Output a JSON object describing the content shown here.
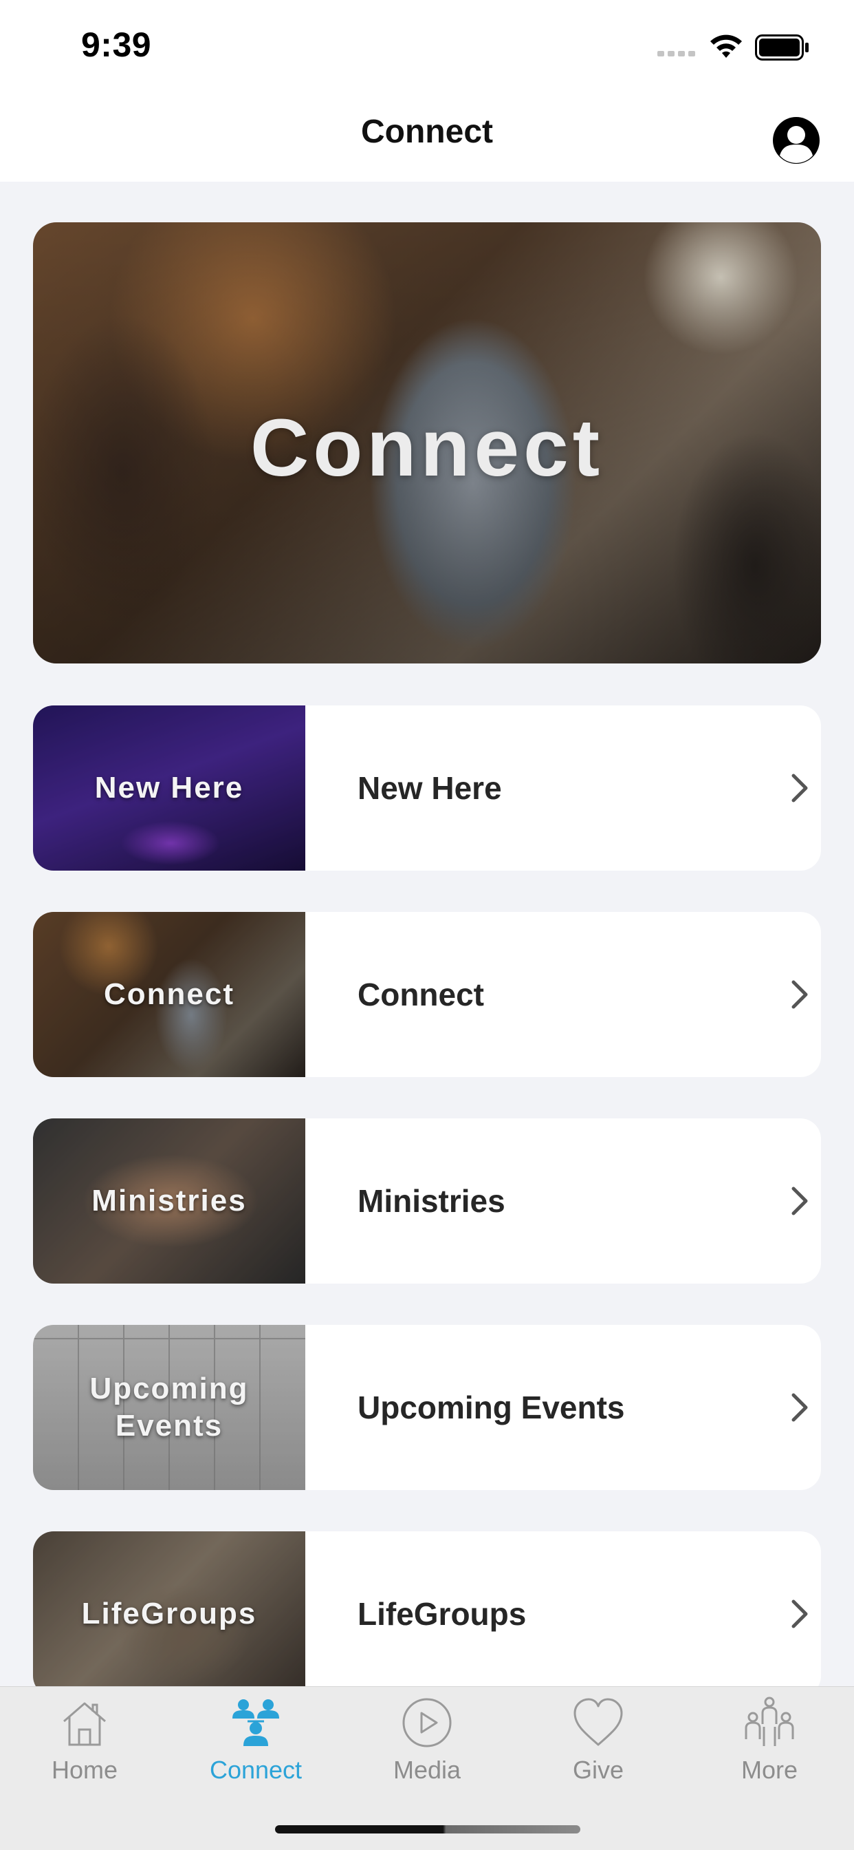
{
  "status_bar": {
    "time": "9:39",
    "icons": [
      "signal-icon",
      "wifi-icon",
      "battery-icon"
    ]
  },
  "nav": {
    "title": "Connect",
    "profile_icon": "profile-icon"
  },
  "hero": {
    "title": "Connect"
  },
  "items": [
    {
      "thumb_label": "New Here",
      "label": "New Here"
    },
    {
      "thumb_label": "Connect",
      "label": "Connect"
    },
    {
      "thumb_label": "Ministries",
      "label": "Ministries"
    },
    {
      "thumb_label": "Upcoming Events",
      "label": "Upcoming Events"
    },
    {
      "thumb_label": "LifeGroups",
      "label": "LifeGroups"
    }
  ],
  "tabs": [
    {
      "label": "Home",
      "icon": "home-icon"
    },
    {
      "label": "Connect",
      "icon": "people-icon",
      "active": true
    },
    {
      "label": "Media",
      "icon": "play-icon"
    },
    {
      "label": "Give",
      "icon": "heart-icon"
    },
    {
      "label": "More",
      "icon": "more-people-icon"
    }
  ],
  "colors": {
    "accent": "#2ba3d8",
    "background": "#f2f3f7",
    "tab_inactive": "#8d8d8d"
  }
}
